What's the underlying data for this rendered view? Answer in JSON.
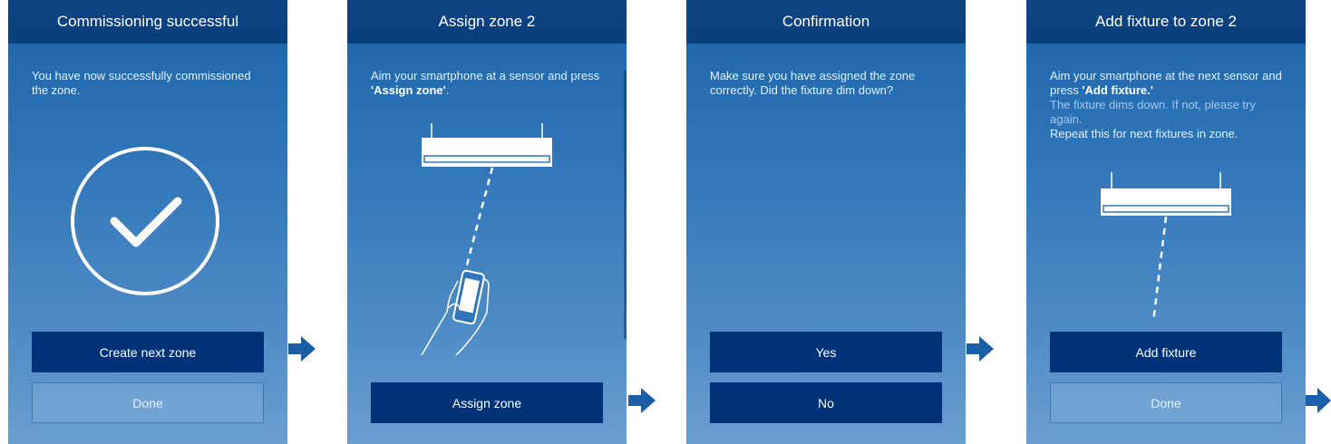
{
  "colors": {
    "header": "#0b4282",
    "gradient_top": "#1b63a8",
    "gradient_bottom": "#6a9fd2",
    "primary_button": "#003278",
    "flow_arrow": "#1a5ea8"
  },
  "screens": [
    {
      "title": "Commissioning successful",
      "instruction": "You have now successfully commissioned the zone.",
      "icon": "check-circle-icon",
      "primary_button": "Create next zone",
      "secondary_button": "Done"
    },
    {
      "title": "Assign zone 2",
      "instruction_prefix": "Aim your smartphone at a sensor and press ",
      "instruction_bold": "'Assign zone'",
      "instruction_suffix": ".",
      "illustration": "fixture-with-hand-smartphone",
      "primary_button": "Assign zone"
    },
    {
      "title": "Confirmation",
      "instruction": "Make sure you have assigned the zone correctly. Did the fixture dim down?",
      "primary_button": "Yes",
      "secondary_button": "No"
    },
    {
      "title": "Add fixture to zone 2",
      "instruction_prefix": "Aim your smartphone at the next sensor and press ",
      "instruction_bold": "'Add fixture.'",
      "instruction_hint": "The fixture dims down. If not, please try again.",
      "instruction_repeat": "Repeat this for next fixtures in zone.",
      "illustration": "fixture-with-beam",
      "primary_button": "Add fixture",
      "secondary_button": "Done"
    }
  ],
  "flow_arrows": [
    "arrow-right-icon",
    "arrow-right-icon",
    "arrow-right-icon",
    "arrow-right-icon"
  ]
}
